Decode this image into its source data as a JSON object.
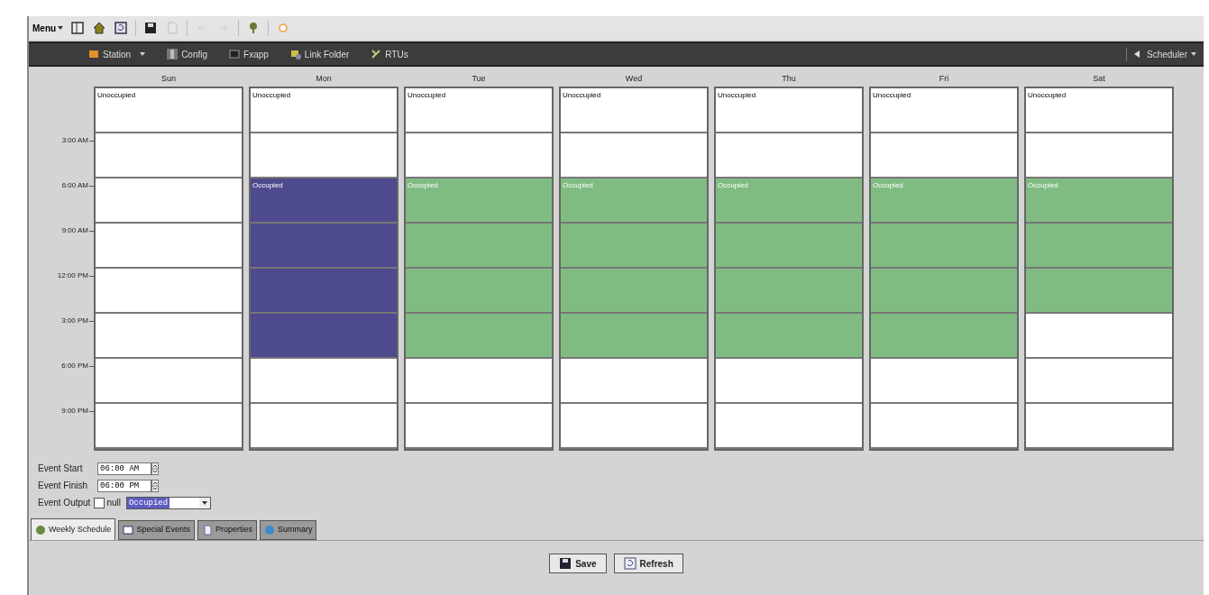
{
  "toolbar": {
    "menu_label": "Menu"
  },
  "nav": {
    "items": [
      {
        "label": "Station",
        "dropdown": true
      },
      {
        "label": "Config",
        "dropdown": false
      },
      {
        "label": "Fxapp",
        "dropdown": false
      },
      {
        "label": "Link Folder",
        "dropdown": false
      },
      {
        "label": "RTUs",
        "dropdown": false
      }
    ],
    "right": "Scheduler"
  },
  "time_labels": [
    "3:00 AM",
    "6:00 AM",
    "9:00 AM",
    "12:00 PM",
    "3:00 PM",
    "6:00 PM",
    "9:00 PM"
  ],
  "days": [
    {
      "name": "Sun",
      "slots": [
        {
          "label": "Unoccupied",
          "occupied": false,
          "selected": false
        },
        {
          "occupied": false,
          "selected": false
        },
        {
          "occupied": false,
          "selected": false
        },
        {
          "occupied": false,
          "selected": false
        },
        {
          "occupied": false,
          "selected": false
        },
        {
          "occupied": false,
          "selected": false
        },
        {
          "occupied": false,
          "selected": false
        },
        {
          "occupied": false,
          "selected": false
        }
      ]
    },
    {
      "name": "Mon",
      "slots": [
        {
          "label": "Unoccupied",
          "occupied": false,
          "selected": false
        },
        {
          "occupied": false,
          "selected": false
        },
        {
          "label": "Occupied",
          "occupied": true,
          "selected": true
        },
        {
          "occupied": true,
          "selected": true
        },
        {
          "occupied": true,
          "selected": true
        },
        {
          "occupied": true,
          "selected": true
        },
        {
          "occupied": false,
          "selected": false
        },
        {
          "occupied": false,
          "selected": false
        }
      ]
    },
    {
      "name": "Tue",
      "slots": [
        {
          "label": "Unoccupied",
          "occupied": false,
          "selected": false
        },
        {
          "occupied": false,
          "selected": false
        },
        {
          "label": "Occupied",
          "occupied": true,
          "selected": false
        },
        {
          "occupied": true,
          "selected": false
        },
        {
          "occupied": true,
          "selected": false
        },
        {
          "occupied": true,
          "selected": false
        },
        {
          "occupied": false,
          "selected": false
        },
        {
          "occupied": false,
          "selected": false
        }
      ]
    },
    {
      "name": "Wed",
      "slots": [
        {
          "label": "Unoccupied",
          "occupied": false,
          "selected": false
        },
        {
          "occupied": false,
          "selected": false
        },
        {
          "label": "Occupied",
          "occupied": true,
          "selected": false
        },
        {
          "occupied": true,
          "selected": false
        },
        {
          "occupied": true,
          "selected": false
        },
        {
          "occupied": true,
          "selected": false
        },
        {
          "occupied": false,
          "selected": false
        },
        {
          "occupied": false,
          "selected": false
        }
      ]
    },
    {
      "name": "Thu",
      "slots": [
        {
          "label": "Unoccupied",
          "occupied": false,
          "selected": false
        },
        {
          "occupied": false,
          "selected": false
        },
        {
          "label": "Occupied",
          "occupied": true,
          "selected": false
        },
        {
          "occupied": true,
          "selected": false
        },
        {
          "occupied": true,
          "selected": false
        },
        {
          "occupied": true,
          "selected": false
        },
        {
          "occupied": false,
          "selected": false
        },
        {
          "occupied": false,
          "selected": false
        }
      ]
    },
    {
      "name": "Fri",
      "slots": [
        {
          "label": "Unoccupied",
          "occupied": false,
          "selected": false
        },
        {
          "occupied": false,
          "selected": false
        },
        {
          "label": "Occupied",
          "occupied": true,
          "selected": false
        },
        {
          "occupied": true,
          "selected": false
        },
        {
          "occupied": true,
          "selected": false
        },
        {
          "occupied": true,
          "selected": false
        },
        {
          "occupied": false,
          "selected": false
        },
        {
          "occupied": false,
          "selected": false
        }
      ]
    },
    {
      "name": "Sat",
      "slots": [
        {
          "label": "Unoccupied",
          "occupied": false,
          "selected": false
        },
        {
          "occupied": false,
          "selected": false
        },
        {
          "label": "Occupied",
          "occupied": true,
          "selected": false
        },
        {
          "occupied": true,
          "selected": false
        },
        {
          "occupied": true,
          "selected": false
        },
        {
          "occupied": false,
          "selected": false
        },
        {
          "occupied": false,
          "selected": false
        },
        {
          "occupied": false,
          "selected": false
        }
      ]
    }
  ],
  "event": {
    "start_label": "Event Start",
    "start_value": "06:00 AM",
    "finish_label": "Event Finish",
    "finish_value": "06:00 PM",
    "output_label": "Event Output",
    "null_checked": false,
    "null_label": "null",
    "output_value": "Occupied"
  },
  "tabs": [
    {
      "label": "Weekly Schedule",
      "selected": true
    },
    {
      "label": "Special Events",
      "selected": false
    },
    {
      "label": "Properties",
      "selected": false
    },
    {
      "label": "Summary",
      "selected": false
    }
  ],
  "buttons": [
    {
      "label": "Save",
      "kind": "save"
    },
    {
      "label": "Refresh",
      "kind": "refresh"
    }
  ]
}
